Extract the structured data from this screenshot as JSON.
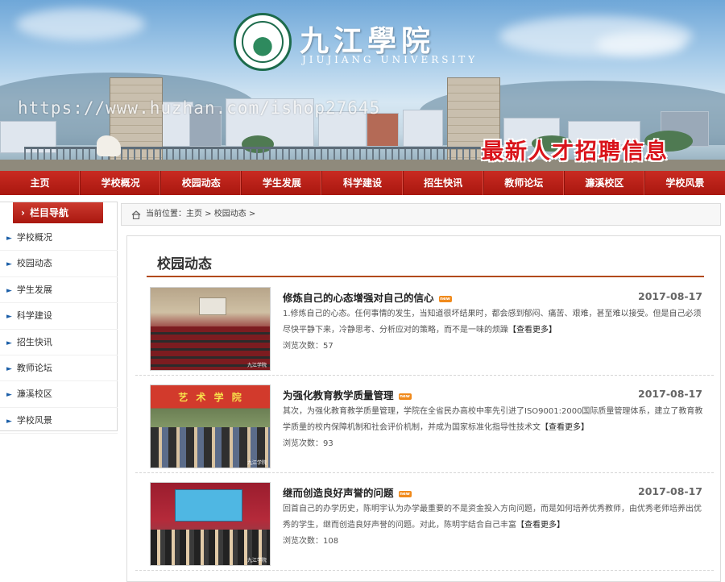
{
  "banner": {
    "logo_cn": "九江學院",
    "logo_en": "JIUJIANG UNIVERSITY",
    "watermark": "https://www.huzhan.com/ishop27645",
    "recruit": "最新人才招聘信息"
  },
  "nav": {
    "items": [
      "主页",
      "学校概况",
      "校园动态",
      "学生发展",
      "科学建设",
      "招生快讯",
      "教师论坛",
      "濂溪校区",
      "学校风景"
    ]
  },
  "sidebar": {
    "heading": "栏目导航",
    "items": [
      "学校概况",
      "校园动态",
      "学生发展",
      "科学建设",
      "招生快讯",
      "教师论坛",
      "濂溪校区",
      "学校风景"
    ]
  },
  "breadcrumb": {
    "text": "当前位置：主页 > 校园动态 >"
  },
  "content": {
    "section_title": "校园动态",
    "articles": [
      {
        "title": "修炼自己的心态增强对自己的信心",
        "date": "2017-08-17",
        "summary": "1.修炼自己的心态。任何事情的发生，当知道很坏结果时，都会感到郁闷、痛苦、艰难，甚至难以接受。但是自己必须尽快平静下来，冷静思考、分析应对的策略，而不是一味的烦躁",
        "more": "【查看更多】",
        "views": "浏览次数：57"
      },
      {
        "title": "为强化教育教学质量管理",
        "date": "2017-08-17",
        "summary": "其次，为强化教育教学质量管理，学院在全省民办高校中率先引进了ISO9001:2000国际质量管理体系，建立了教育教学质量的校内保障机制和社会评价机制，并成为国家标准化指导性技术文",
        "more": "【查看更多】",
        "views": "浏览次数：93"
      },
      {
        "title": "继而创造良好声誉的问题",
        "date": "2017-08-17",
        "summary": "回首自己的办学历史，陈明宇认为办学最重要的不是资金投入方向问题，而是如何培养优秀教师，由优秀老师培养出优秀的学生，继而创造良好声誉的问题。对此，陈明宇结合自己丰富",
        "more": "【查看更多】",
        "views": "浏览次数：108"
      }
    ],
    "thumb2_sign": "艺 术 学 院"
  },
  "colors": {
    "nav_red": "#b41d14",
    "accent_rule": "#b24a19",
    "recruit_red": "#d9141b",
    "new_badge": "#f08a1c"
  },
  "icons": {
    "breadcrumb": "home-icon",
    "sidebar_items": "chevron-right-icon",
    "sidebar_heading": "arrow-right-icon"
  }
}
